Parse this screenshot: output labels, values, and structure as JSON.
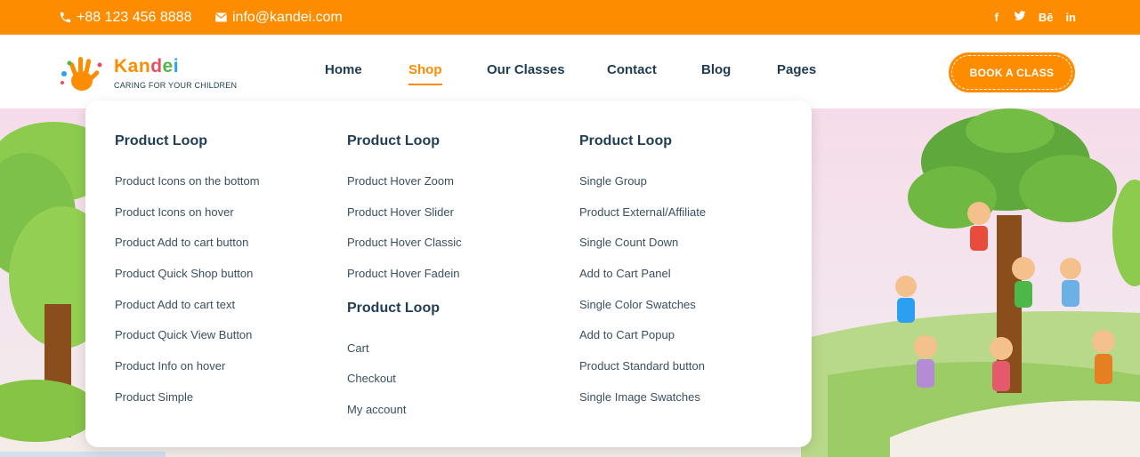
{
  "topbar": {
    "phone": "+88 123 456 8888",
    "email": "info@kandei.com",
    "social": [
      {
        "icon": "facebook-icon",
        "glyph": "f"
      },
      {
        "icon": "twitter-icon",
        "glyph": "🐦"
      },
      {
        "icon": "behance-icon",
        "glyph": "Bē"
      },
      {
        "icon": "linkedin-icon",
        "glyph": "in"
      }
    ]
  },
  "brand": {
    "name": "Kandei",
    "tagline": "CARING FOR YOUR CHILDREN"
  },
  "nav": {
    "items": [
      "Home",
      "Shop",
      "Our Classes",
      "Contact",
      "Blog",
      "Pages"
    ],
    "active": "Shop"
  },
  "cta": {
    "label": "BOOK A CLASS"
  },
  "mega_menu": {
    "col1": {
      "heading": "Product Loop",
      "links": [
        "Product Icons on the bottom",
        "Product Icons on hover",
        "Product Add to cart button",
        "Product Quick Shop button",
        "Product Add to cart text",
        "Product Quick View Button",
        "Product Info on hover",
        "Product Simple"
      ]
    },
    "col2": {
      "heading": "Product Loop",
      "links": [
        "Product Hover Zoom",
        "Product Hover Slider",
        "Product Hover Classic",
        "Product Hover Fadein"
      ],
      "heading2": "Product Loop",
      "links2": [
        "Cart",
        "Checkout",
        "My account"
      ]
    },
    "col3": {
      "heading": "Product Loop",
      "links": [
        "Single Group",
        "Product External/Affiliate",
        "Single Count Down",
        "Add to Cart Panel",
        "Single Color Swatches",
        "Add to Cart Popup",
        "Product Standard button",
        "Single Image Swatches"
      ]
    }
  },
  "colors": {
    "accent": "#fe8c00",
    "nav_text": "#1e3b52"
  }
}
